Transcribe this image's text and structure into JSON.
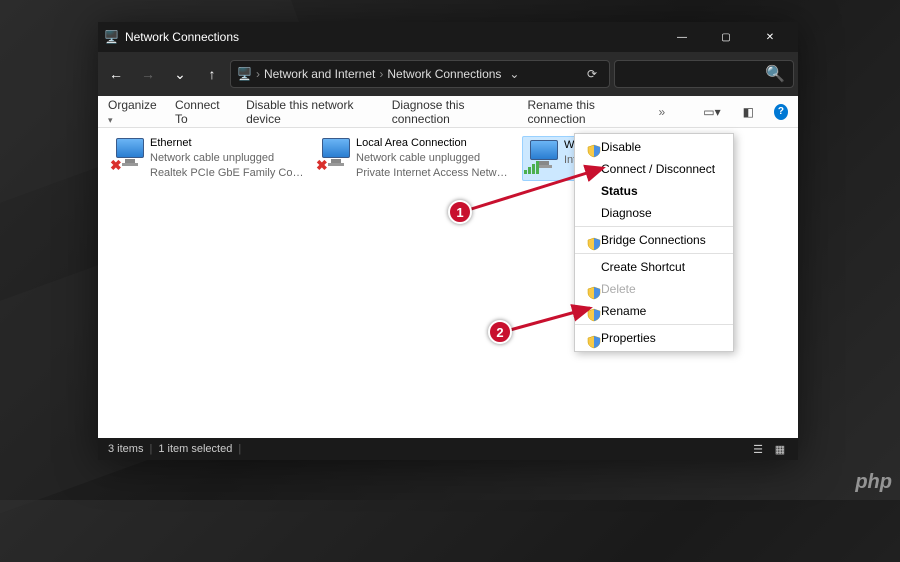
{
  "window": {
    "title": "Network Connections",
    "controls": {
      "minimize": "—",
      "maximize": "▢",
      "close": "✕"
    }
  },
  "nav": {
    "back": "←",
    "forward": "→",
    "recent": "⌄",
    "up": "↑",
    "breadcrumb": {
      "part1": "Network and Internet",
      "part2": "Network Connections",
      "sep": "›"
    },
    "refresh": "⟳"
  },
  "search": {
    "placeholder": "",
    "icon": "🔍"
  },
  "cmdbar": {
    "organize": "Organize",
    "connect": "Connect To",
    "disable_device": "Disable this network device",
    "diagnose": "Diagnose this connection",
    "rename": "Rename this connection",
    "overflow": "»",
    "help": "?"
  },
  "adapters": [
    {
      "name": "Ethernet",
      "status": "Network cable unplugged",
      "device": "Realtek PCIe GbE Family Controller",
      "state": "disconnected"
    },
    {
      "name": "Local Area Connection",
      "status": "Network cable unplugged",
      "device": "Private Internet Access Network A...",
      "state": "disconnected"
    },
    {
      "name": "Wi-Fi",
      "status": " ",
      "device": "Intel(R)",
      "state": "connected",
      "selected": true
    }
  ],
  "context_menu": {
    "items": [
      {
        "label": "Disable",
        "shield": true
      },
      {
        "label": "Connect / Disconnect"
      },
      {
        "label": "Status",
        "bold": true
      },
      {
        "label": "Diagnose"
      },
      {
        "sep": true
      },
      {
        "label": "Bridge Connections",
        "shield": true
      },
      {
        "sep": true
      },
      {
        "label": "Create Shortcut"
      },
      {
        "label": "Delete",
        "shield": true,
        "disabled": true
      },
      {
        "label": "Rename",
        "shield": true
      },
      {
        "sep": true
      },
      {
        "label": "Properties",
        "shield": true
      }
    ]
  },
  "statusbar": {
    "count": "3 items",
    "selected": "1 item selected"
  },
  "markers": {
    "m1": "1",
    "m2": "2"
  },
  "watermark": "php"
}
